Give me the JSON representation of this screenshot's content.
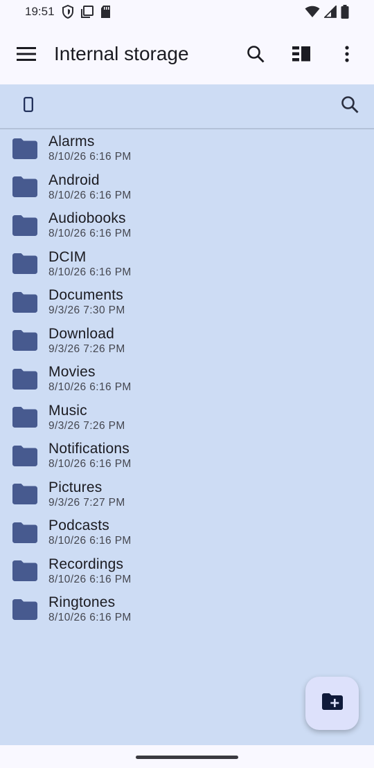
{
  "status_bar": {
    "time": "19:51",
    "icons": [
      "shield-icon",
      "screenshot-icon",
      "sd-card-icon",
      "wifi-icon",
      "signal-icon",
      "battery-icon"
    ]
  },
  "app_bar": {
    "title": "Internal storage",
    "actions": [
      "search-icon",
      "grid-view-icon",
      "more-options-icon"
    ]
  },
  "breadcrumb": {
    "root_icon": "phone-icon",
    "search_icon": "search-icon"
  },
  "files": [
    {
      "name": "Alarms",
      "date": "8/10/26 6:16 PM"
    },
    {
      "name": "Android",
      "date": "8/10/26 6:16 PM"
    },
    {
      "name": "Audiobooks",
      "date": "8/10/26 6:16 PM"
    },
    {
      "name": "DCIM",
      "date": "8/10/26 6:16 PM"
    },
    {
      "name": "Documents",
      "date": "9/3/26 7:30 PM"
    },
    {
      "name": "Download",
      "date": "9/3/26 7:26 PM"
    },
    {
      "name": "Movies",
      "date": "8/10/26 6:16 PM"
    },
    {
      "name": "Music",
      "date": "9/3/26 7:26 PM"
    },
    {
      "name": "Notifications",
      "date": "8/10/26 6:16 PM"
    },
    {
      "name": "Pictures",
      "date": "9/3/26 7:27 PM"
    },
    {
      "name": "Podcasts",
      "date": "8/10/26 6:16 PM"
    },
    {
      "name": "Recordings",
      "date": "8/10/26 6:16 PM"
    },
    {
      "name": "Ringtones",
      "date": "8/10/26 6:16 PM"
    }
  ],
  "fab": {
    "icon": "create-folder-icon"
  },
  "colors": {
    "content_bg": "#cddcf4",
    "folder": "#475a8f",
    "fab_bg": "#dde1fb",
    "appbar_bg": "#f9f8ff"
  }
}
